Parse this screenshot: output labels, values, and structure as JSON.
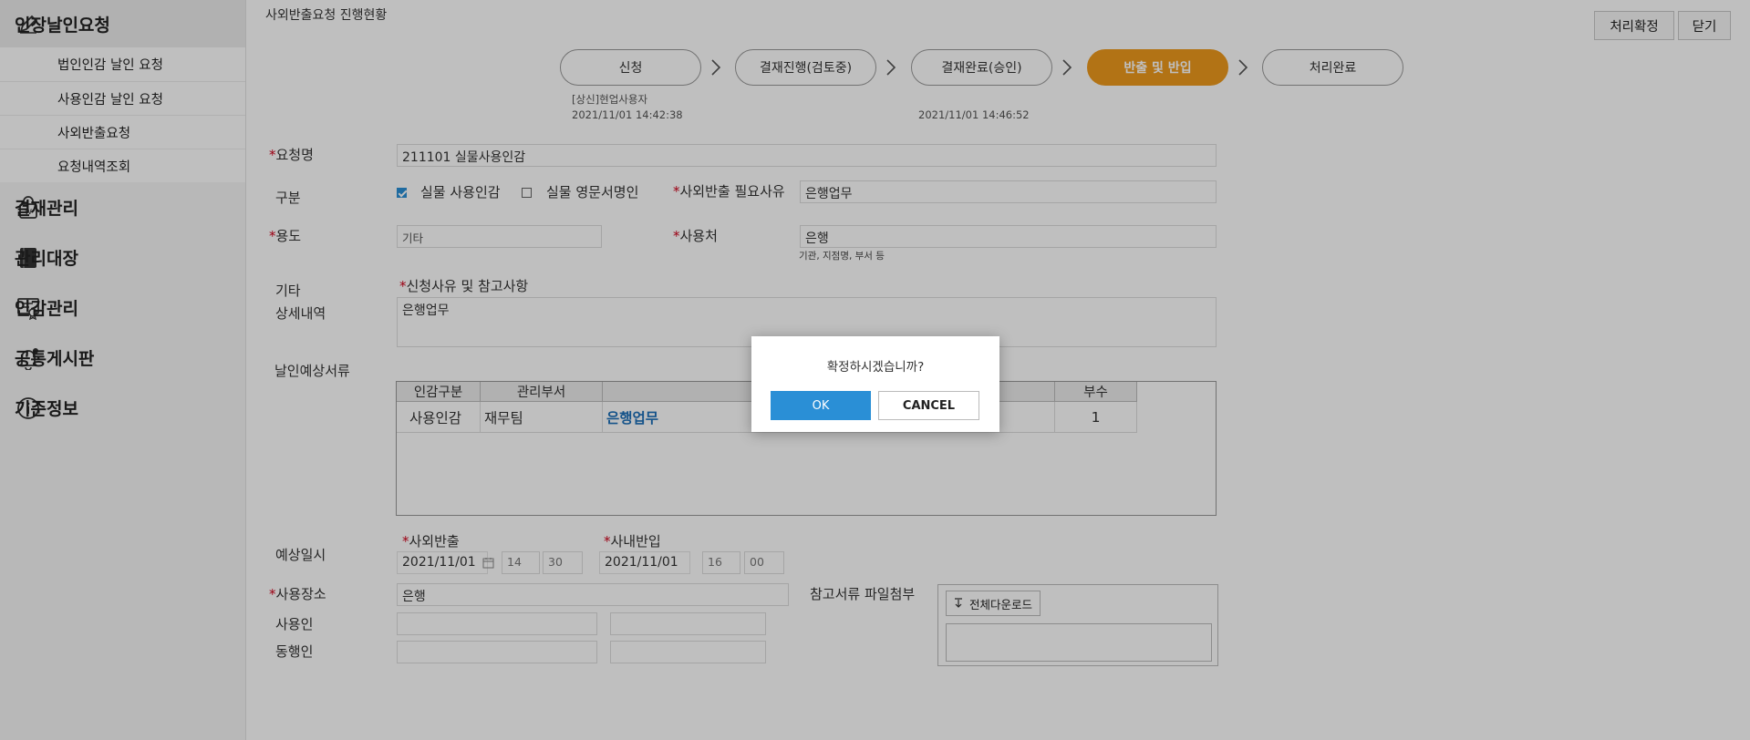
{
  "sidebar": {
    "sections": [
      {
        "label": "인장날인요청",
        "icon": "pen-icon",
        "items": [
          "법인인감 날인 요청",
          "사용인감 날인 요청",
          "사외반출요청",
          "요청내역조회"
        ]
      },
      {
        "label": "결재관리",
        "icon": "bag-icon"
      },
      {
        "label": "관리대장",
        "icon": "book-icon"
      },
      {
        "label": "인감관리",
        "icon": "certificate-icon"
      },
      {
        "label": "공통게시판",
        "icon": "bell-icon"
      },
      {
        "label": "기준정보",
        "icon": "info-icon"
      }
    ]
  },
  "header": {
    "title": "사외반출요청 진행현황",
    "confirm_label": "처리확정",
    "close_label": "닫기"
  },
  "steps": [
    {
      "label": "신청"
    },
    {
      "label": "결재진행(검토중)"
    },
    {
      "label": "결재완료(승인)"
    },
    {
      "label": "반출 및 반입",
      "current": true
    },
    {
      "label": "처리완료"
    }
  ],
  "step_info": {
    "submitter": "[상신]현업사용자",
    "submit_time": "2021/11/01 14:42:38",
    "approve_time": "2021/11/01 14:46:52"
  },
  "form": {
    "required_mark": "*",
    "request_name_label": "요청명",
    "request_name_value": "211101 실물사용인감",
    "category_label": "구분",
    "category_options": [
      {
        "label": "실물 사용인감",
        "checked": true
      },
      {
        "label": "실물 영문서명인",
        "checked": false
      }
    ],
    "export_reason_label": "사외반출 필요사유",
    "export_reason_value": "은행업무",
    "purpose_label": "용도",
    "purpose_value": "기타",
    "destination_label": "사용처",
    "destination_value": "은행",
    "destination_hint": "기관, 지점명, 부서 등",
    "other_label_1": "기타",
    "other_label_2": "상세내역",
    "reason_label": "신청사유 및 참고사항",
    "reason_value": "은행업무",
    "docs_label": "날인예상서류",
    "docs_table": {
      "headers": [
        "인감구분",
        "관리부서",
        "",
        "부수"
      ],
      "rows": [
        [
          "사용인감",
          "재무팀",
          "은행업무",
          "1"
        ]
      ]
    },
    "schedule_label": "예상일시",
    "export_label": "사외반출",
    "export_date": "2021/11/01",
    "export_hour": "14",
    "export_min": "30",
    "return_label": "사내반입",
    "return_date": "2021/11/01",
    "return_hour": "16",
    "return_min": "00",
    "place_label": "사용장소",
    "place_value": "은행",
    "user_label": "사용인",
    "companion_label": "동행인",
    "attach_label": "참고서류 파일첨부",
    "download_label": "전체다운로드"
  },
  "dialog": {
    "message": "확정하시겠습니까?",
    "ok_label": "OK",
    "cancel_label": "CANCEL"
  },
  "colors": {
    "accent": "#2a8fd6",
    "current_step": "#ee9a1d",
    "required": "#d0021b",
    "link": "#1c6fb8"
  }
}
